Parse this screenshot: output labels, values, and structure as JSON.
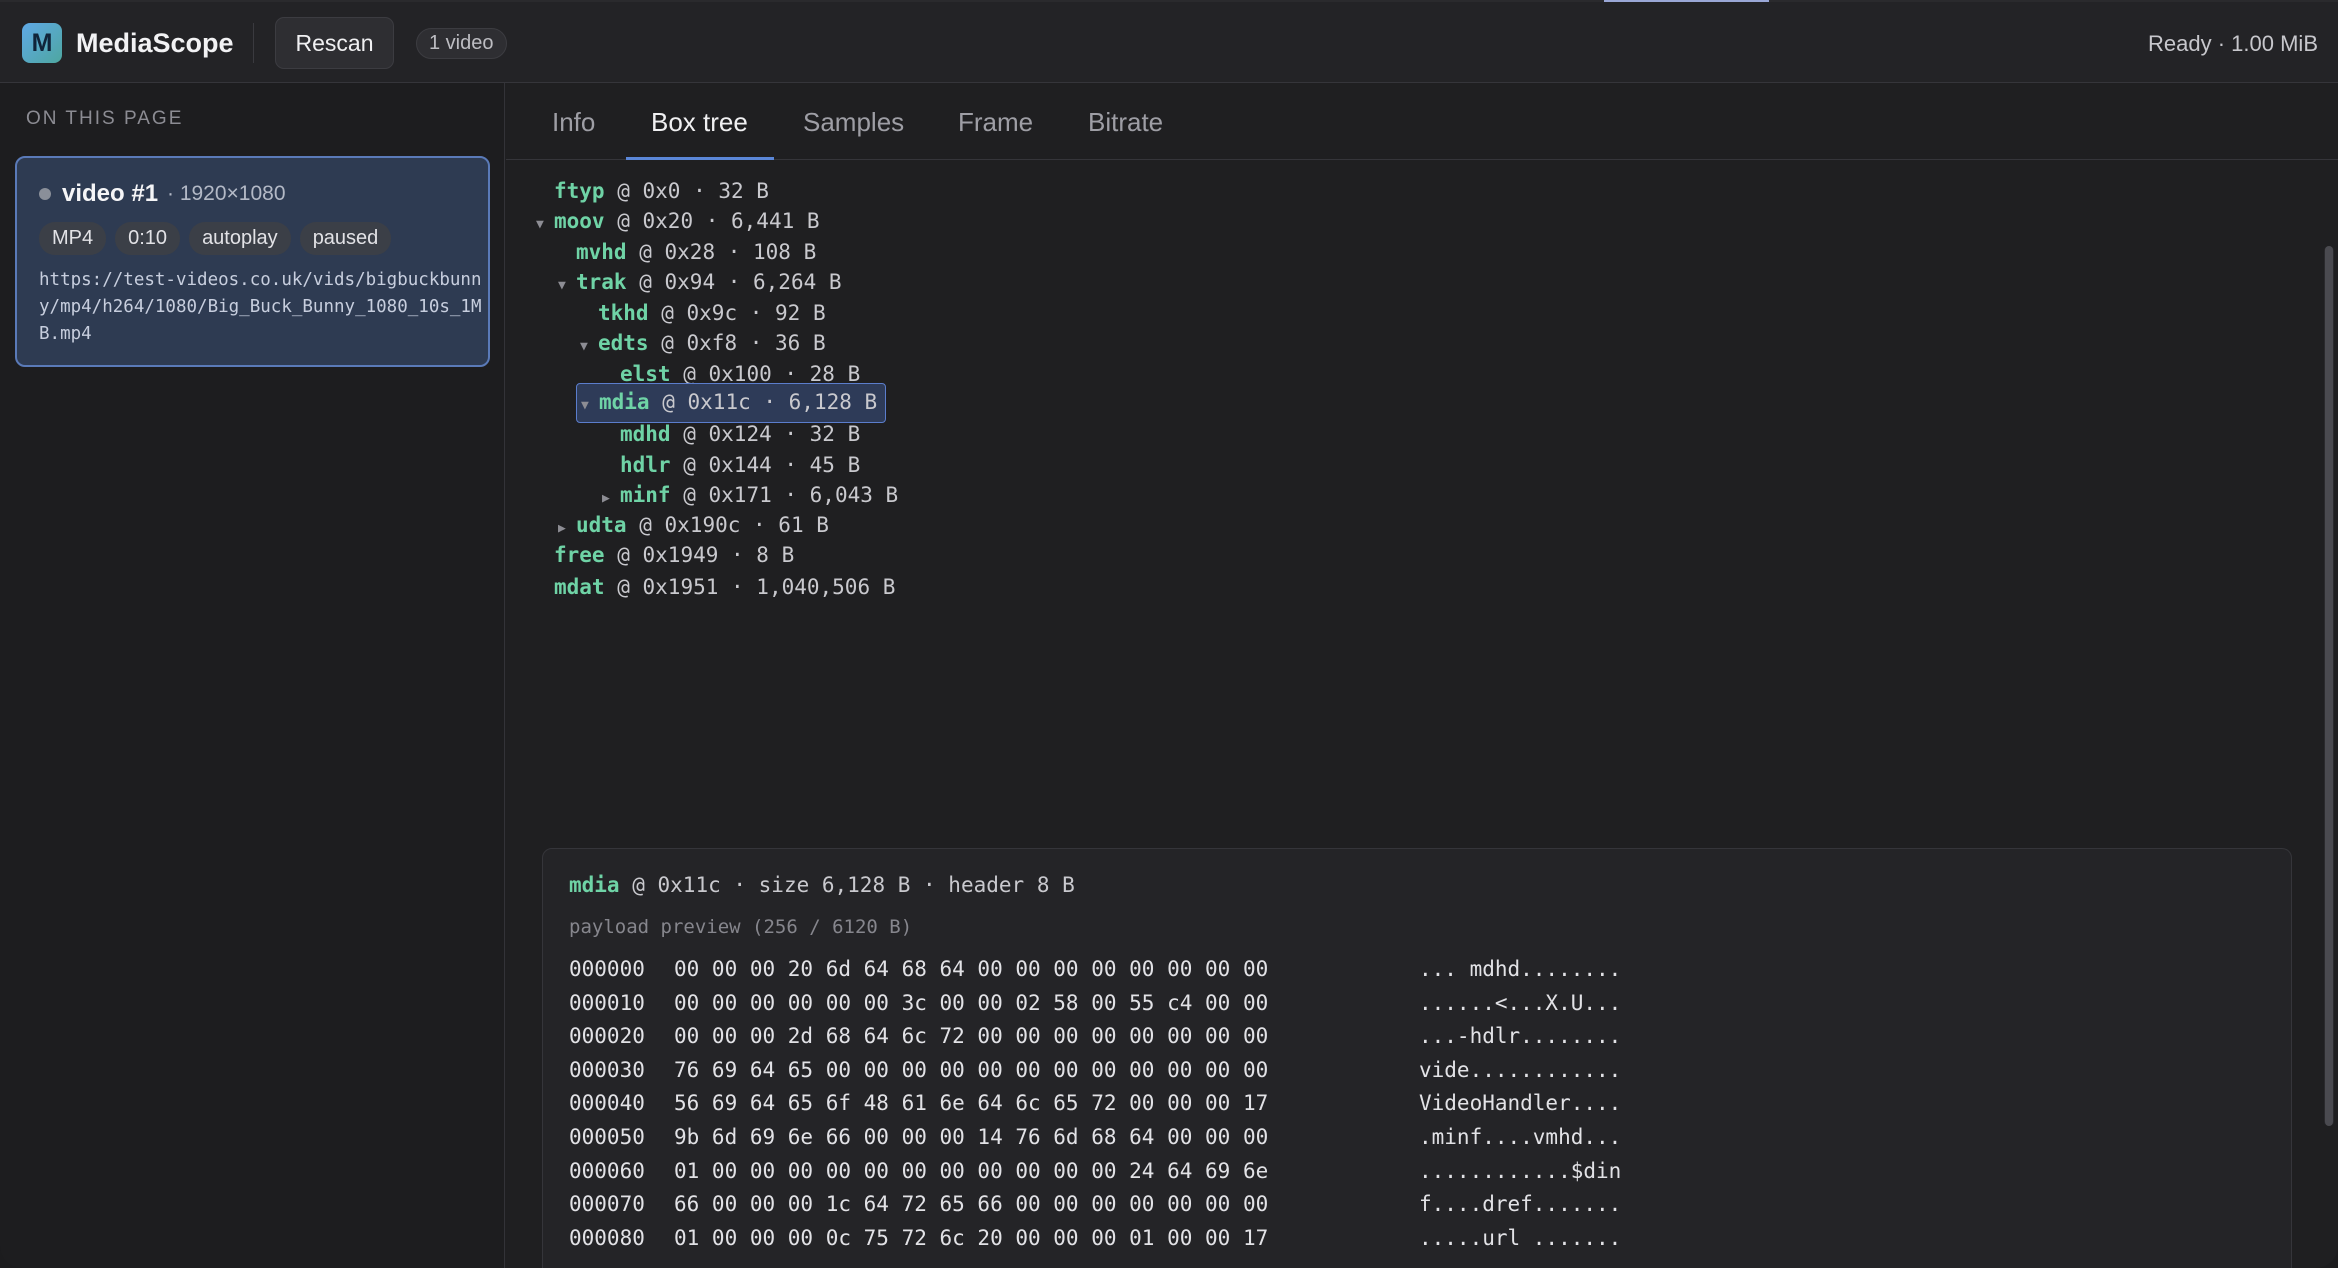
{
  "header": {
    "logo_letter": "M",
    "app_name": "MediaScope",
    "rescan_label": "Rescan",
    "video_count": "1 video",
    "status": "Ready · 1.00 MiB"
  },
  "sidebar": {
    "heading": "ON THIS PAGE",
    "videos": [
      {
        "title": "video #1",
        "dims": "· 1920×1080",
        "tags": [
          "MP4",
          "0:10",
          "autoplay",
          "paused"
        ],
        "url": "https://test-videos.co.uk/vids/bigbuckbunny/mp4/h264/1080/Big_Buck_Bunny_1080_10s_1MB.mp4"
      }
    ]
  },
  "tabs": [
    {
      "label": "Info",
      "active": false
    },
    {
      "label": "Box tree",
      "active": true
    },
    {
      "label": "Samples",
      "active": false
    },
    {
      "label": "Frame",
      "active": false
    },
    {
      "label": "Bitrate",
      "active": false
    }
  ],
  "tree": [
    {
      "name": "ftyp",
      "info": "@ 0x0 · 32 B",
      "depth": 0,
      "toggle": ""
    },
    {
      "name": "moov",
      "info": "@ 0x20 · 6,441 B",
      "depth": 0,
      "toggle": "▼"
    },
    {
      "name": "mvhd",
      "info": "@ 0x28 · 108 B",
      "depth": 1,
      "toggle": ""
    },
    {
      "name": "trak",
      "info": "@ 0x94 · 6,264 B",
      "depth": 1,
      "toggle": "▼"
    },
    {
      "name": "tkhd",
      "info": "@ 0x9c · 92 B",
      "depth": 2,
      "toggle": ""
    },
    {
      "name": "edts",
      "info": "@ 0xf8 · 36 B",
      "depth": 2,
      "toggle": "▼"
    },
    {
      "name": "elst",
      "info": "@ 0x100 · 28 B",
      "depth": 3,
      "toggle": ""
    },
    {
      "name": "mdia",
      "info": "@ 0x11c · 6,128 B",
      "depth": 2,
      "toggle": "▼",
      "selected": true
    },
    {
      "name": "mdhd",
      "info": "@ 0x124 · 32 B",
      "depth": 3,
      "toggle": ""
    },
    {
      "name": "hdlr",
      "info": "@ 0x144 · 45 B",
      "depth": 3,
      "toggle": ""
    },
    {
      "name": "minf",
      "info": "@ 0x171 · 6,043 B",
      "depth": 3,
      "toggle": "▶"
    },
    {
      "name": "udta",
      "info": "@ 0x190c · 61 B",
      "depth": 1,
      "toggle": "▶"
    },
    {
      "name": "free",
      "info": "@ 0x1949 · 8 B",
      "depth": 0,
      "toggle": ""
    },
    {
      "name": "mdat",
      "info": "@ 0x1951 · 1,040,506 B",
      "depth": 0,
      "toggle": ""
    }
  ],
  "detail": {
    "box_name": "mdia",
    "box_info": "@ 0x11c · size 6,128 B · header 8 B",
    "preview_label": "payload preview (256 / 6120 B)",
    "hex_rows": [
      {
        "offset": "000000",
        "bytes": "00 00 00 20 6d 64 68 64 00 00 00 00 00 00 00 00",
        "ascii": "... mdhd........"
      },
      {
        "offset": "000010",
        "bytes": "00 00 00 00 00 00 3c 00 00 02 58 00 55 c4 00 00",
        "ascii": "......<...X.U..."
      },
      {
        "offset": "000020",
        "bytes": "00 00 00 2d 68 64 6c 72 00 00 00 00 00 00 00 00",
        "ascii": "...-hdlr........"
      },
      {
        "offset": "000030",
        "bytes": "76 69 64 65 00 00 00 00 00 00 00 00 00 00 00 00",
        "ascii": "vide............"
      },
      {
        "offset": "000040",
        "bytes": "56 69 64 65 6f 48 61 6e 64 6c 65 72 00 00 00 17",
        "ascii": "VideoHandler...."
      },
      {
        "offset": "000050",
        "bytes": "9b 6d 69 6e 66 00 00 00 14 76 6d 68 64 00 00 00",
        "ascii": ".minf....vmhd..."
      },
      {
        "offset": "000060",
        "bytes": "01 00 00 00 00 00 00 00 00 00 00 00 24 64 69 6e",
        "ascii": "............$din"
      },
      {
        "offset": "000070",
        "bytes": "66 00 00 00 1c 64 72 65 66 00 00 00 00 00 00 00",
        "ascii": "f....dref......."
      },
      {
        "offset": "000080",
        "bytes": "01 00 00 00 0c 75 72 6c 20 00 00 00 01 00 00 17",
        "ascii": ".....url ......."
      }
    ]
  }
}
